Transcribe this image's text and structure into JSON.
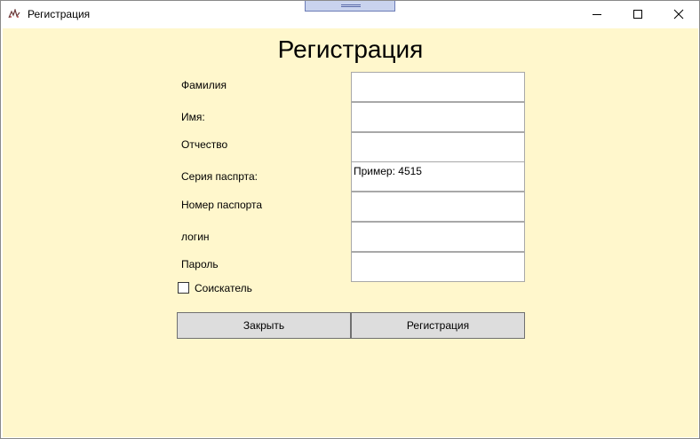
{
  "window": {
    "title": "Регистрация"
  },
  "form": {
    "heading": "Регистрация",
    "fields": [
      {
        "label": "Фамилия",
        "value": ""
      },
      {
        "label": "Имя:",
        "value": ""
      },
      {
        "label": "Отчество",
        "value": ""
      },
      {
        "label": "Серия паспрта:",
        "value": "Пример: 4515"
      },
      {
        "label": "Номер паспорта",
        "value": ""
      },
      {
        "label": "логин",
        "value": ""
      },
      {
        "label": "Пароль",
        "value": ""
      }
    ],
    "checkbox": {
      "label": "Соискатель",
      "checked": false
    },
    "buttons": {
      "close": "Закрыть",
      "register": "Регистрация"
    }
  },
  "colors": {
    "background": "#fff7cc",
    "button": "#dddddd",
    "field_border": "#a8a8a8"
  }
}
